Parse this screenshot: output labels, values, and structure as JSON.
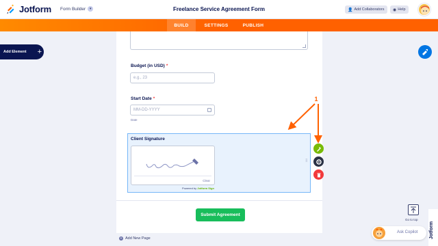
{
  "header": {
    "brand": "Jotform",
    "builder_menu": "Form Builder",
    "form_title": "Freelance Service Agreement Form",
    "add_collaborators": "Add Collaborators",
    "help": "Help"
  },
  "nav": {
    "tabs": [
      {
        "label": "BUILD",
        "active": true
      },
      {
        "label": "SETTINGS",
        "active": false
      },
      {
        "label": "PUBLISH",
        "active": false
      }
    ]
  },
  "sidebar": {
    "add_element": "Add Element"
  },
  "form": {
    "budget": {
      "label": "Budget (in USD)",
      "placeholder": "e.g., 23"
    },
    "start_date": {
      "label": "Start Date",
      "placeholder": "MM-DD-YYYY",
      "sublabel": "Date"
    },
    "signature": {
      "label": "Client Signature",
      "clear": "Clear",
      "powered_prefix": "Powered by",
      "powered_brand": "Jotform Sign"
    },
    "submit": "Submit Agreement",
    "add_new_page": "Add New Page"
  },
  "annotation": {
    "number": "1"
  },
  "go_to_top": "Go to top",
  "copilot": "Ask Copilot",
  "colors": {
    "orange": "#ff6100",
    "navy": "#0a1551",
    "submit_green": "#18bd5b",
    "selection_blue": "#75b6f8",
    "required_red": "#f23a3c"
  },
  "icons": [
    "jotform-logo-icon",
    "chevron-down-icon",
    "user-plus-icon",
    "help-icon",
    "plus-icon",
    "paint-roller-icon",
    "calendar-icon",
    "drag-handle-icon",
    "paint-icon",
    "gear-icon",
    "trash-icon",
    "arrow-up-icon"
  ]
}
